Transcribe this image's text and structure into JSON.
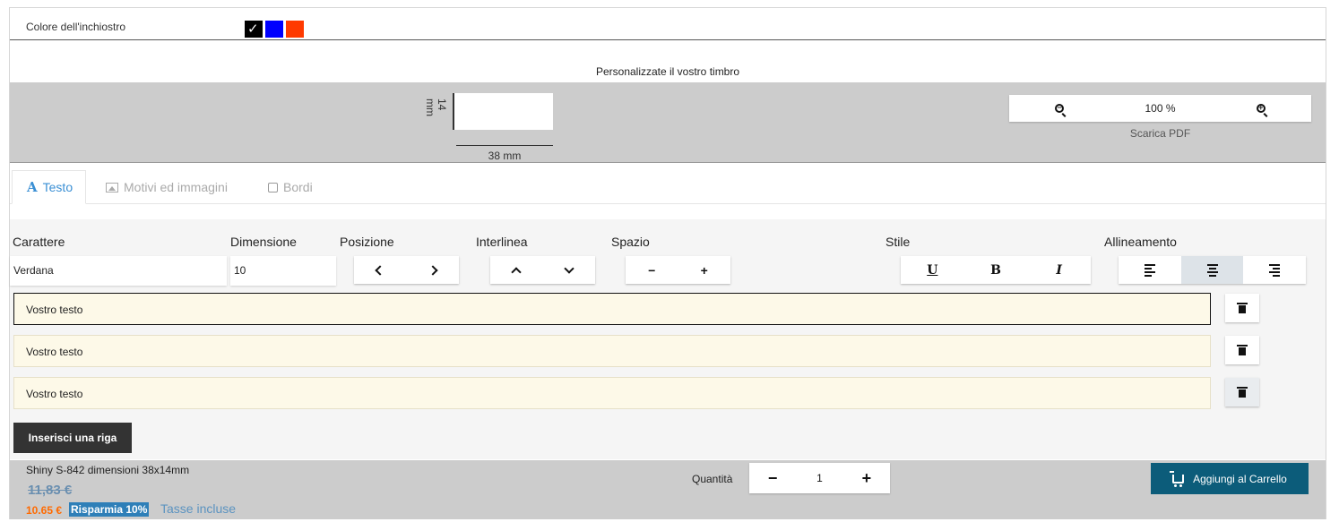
{
  "ink": {
    "label": "Colore dell'inchiostro",
    "colors": [
      {
        "name": "black",
        "hex": "#000000",
        "selected": true
      },
      {
        "name": "blue",
        "hex": "#0000ff",
        "selected": false
      },
      {
        "name": "red",
        "hex": "#ff3a00",
        "selected": false
      }
    ]
  },
  "preview": {
    "title": "Personalizzate il vostro timbro",
    "height_label": "14 mm",
    "width_label": "38 mm",
    "zoom_level": "100 %",
    "download_label": "Scarica PDF"
  },
  "tabs": [
    {
      "label": "Testo",
      "icon": "text-a-icon",
      "active": true
    },
    {
      "label": "Motivi ed immagini",
      "icon": "image-icon",
      "active": false
    },
    {
      "label": "Bordi",
      "icon": "checkbox-icon",
      "active": false
    }
  ],
  "editor": {
    "labels": {
      "font": "Carattere",
      "size": "Dimensione",
      "position": "Posizione",
      "line_spacing": "Interlinea",
      "spacing": "Spazio",
      "style": "Stile",
      "alignment": "Allineamento"
    },
    "font_value": "Verdana",
    "size_value": "10",
    "style_buttons": {
      "underline": "U",
      "bold": "B",
      "italic": "I"
    },
    "spacing_buttons": {
      "minus": "−",
      "plus": "+"
    },
    "alignment_selected": "center",
    "lines": [
      {
        "text": "Vostro testo",
        "focused": true
      },
      {
        "text": "Vostro testo",
        "focused": false
      },
      {
        "text": "Vostro testo",
        "focused": false
      }
    ],
    "add_line_label": "Inserisci una riga"
  },
  "footer": {
    "product_name": "Shiny S-842 dimensioni 38x14mm",
    "old_price": "11,83 €",
    "new_price": "10.65 €",
    "discount_label": "Risparmia 10%",
    "tax_label": "Tasse incluse",
    "quantity_label": "Quantità",
    "quantity_value": "1",
    "cart_label": "Aggiungi al Carrello"
  }
}
